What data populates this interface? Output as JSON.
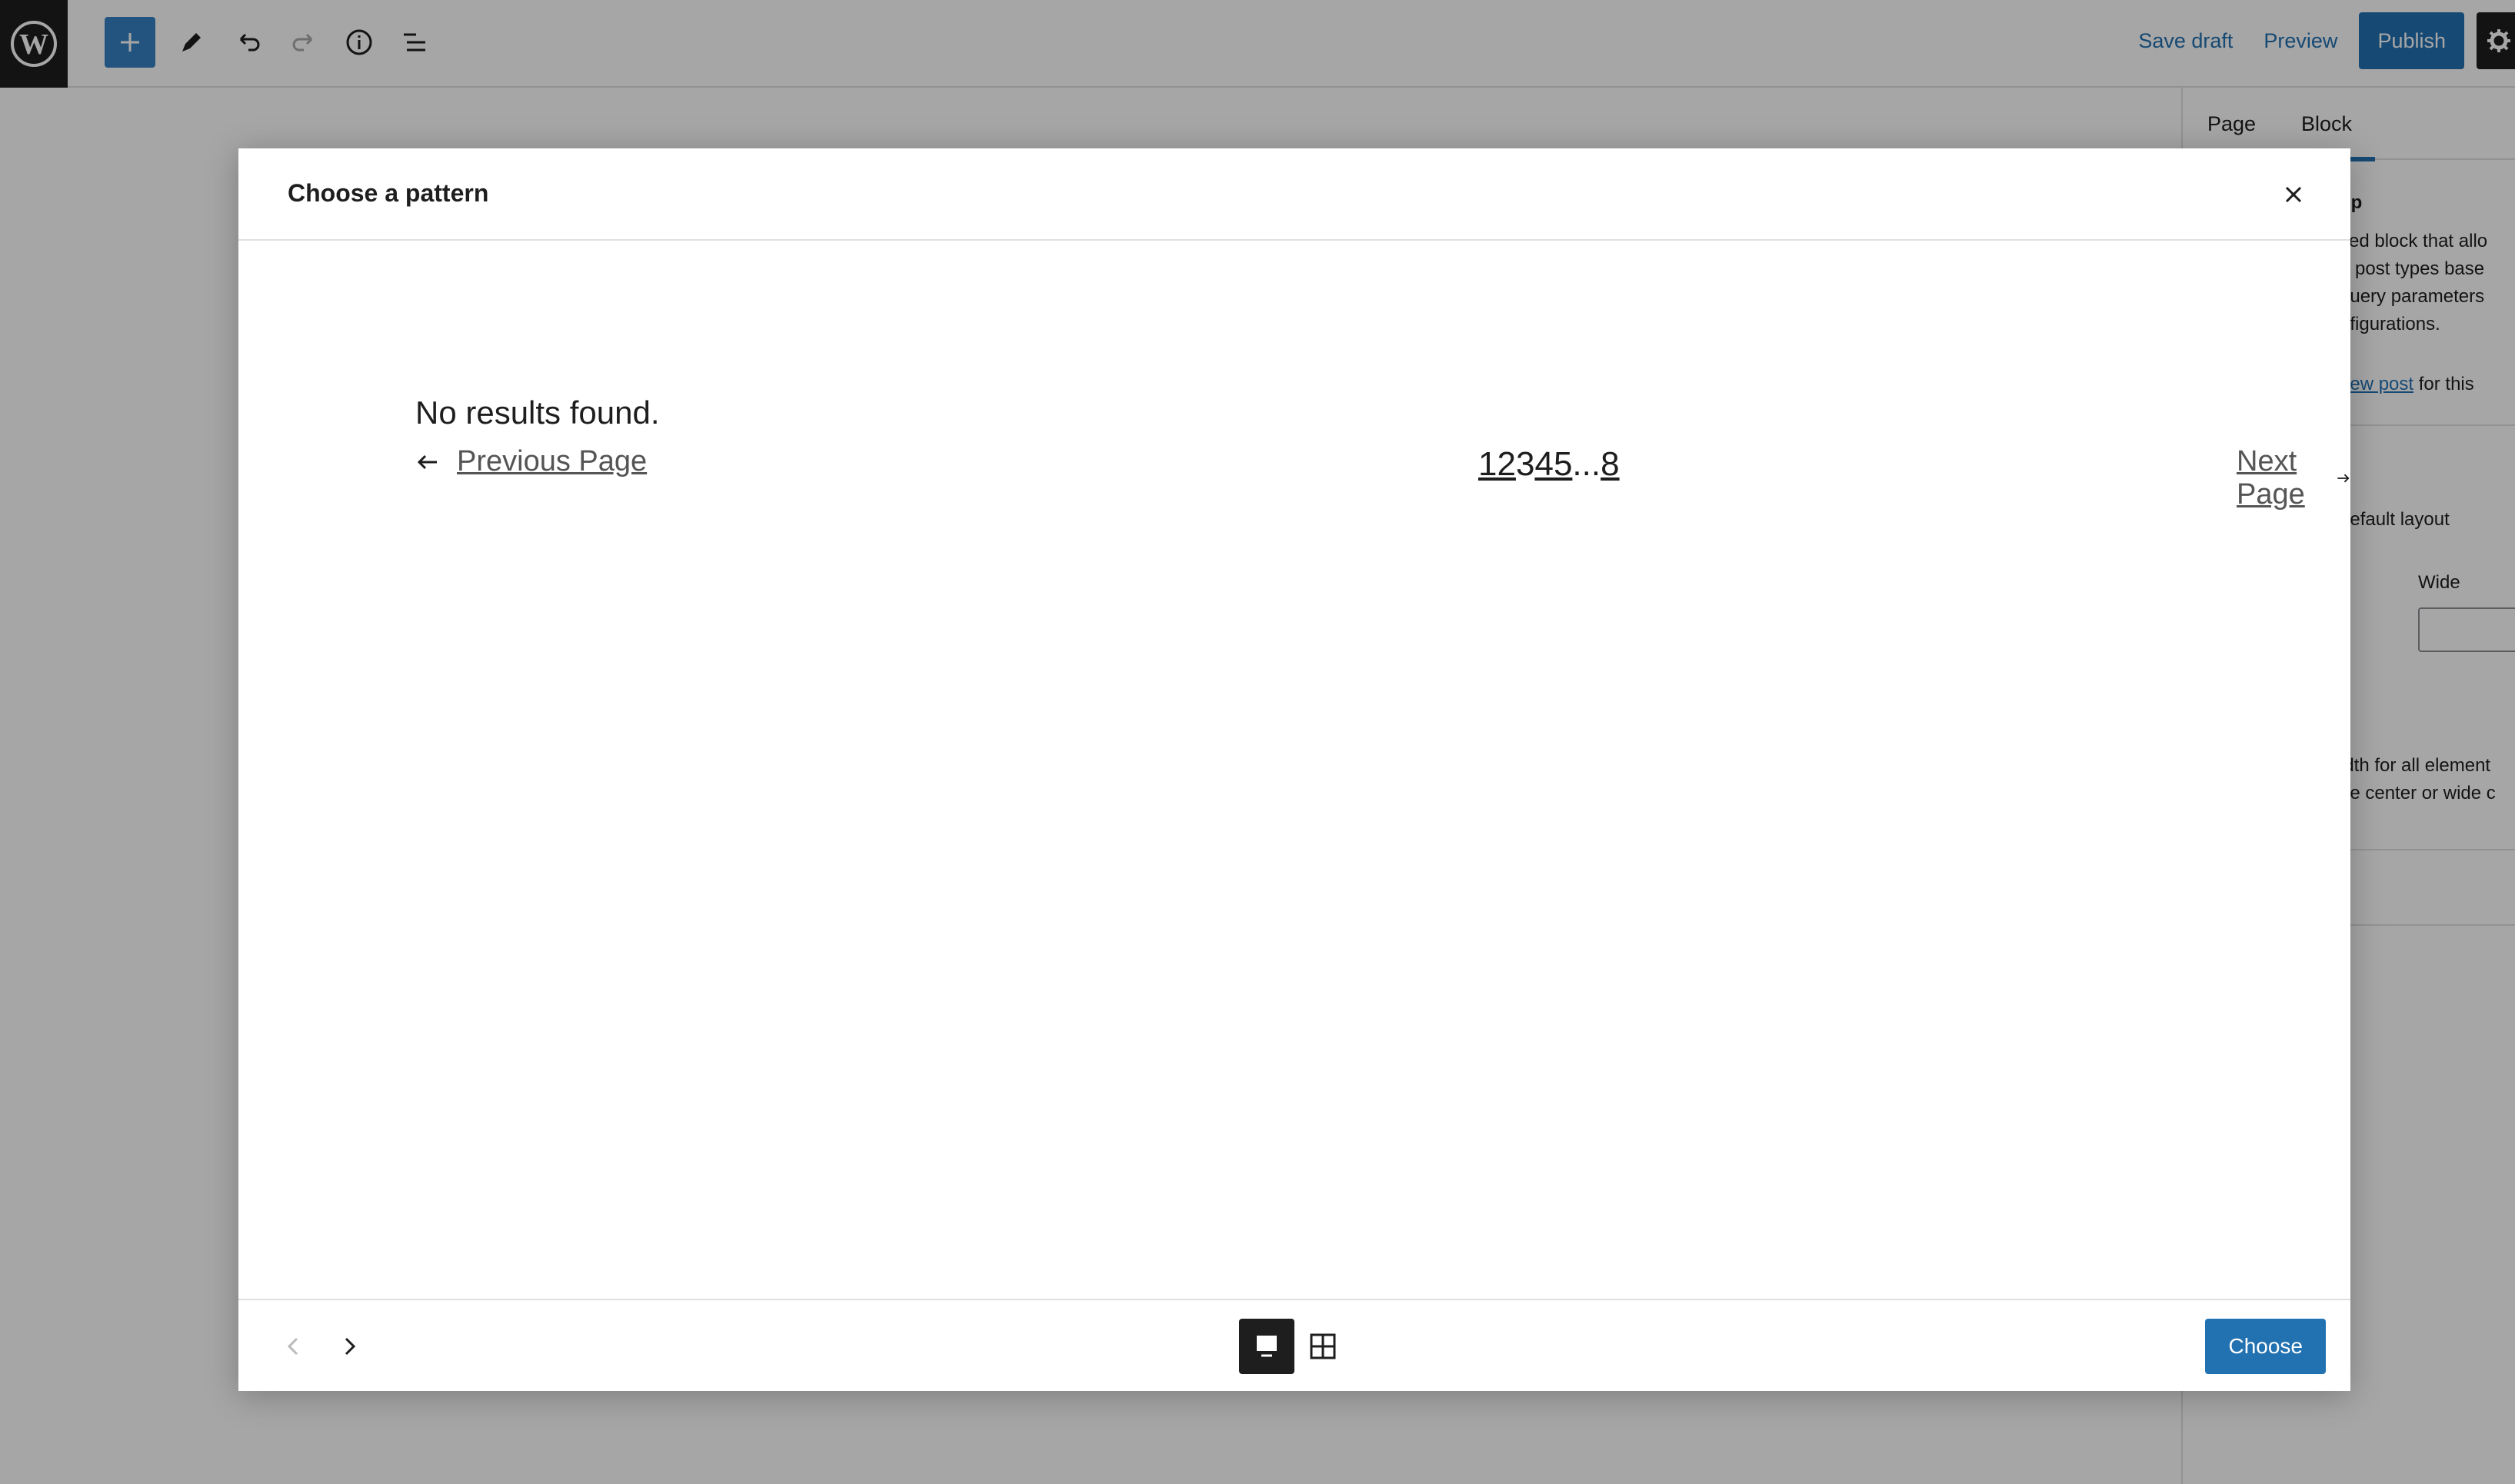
{
  "topbar": {
    "save_draft": "Save draft",
    "preview": "Preview",
    "publish": "Publish"
  },
  "sidebar": {
    "tabs": [
      "Page",
      "Block"
    ],
    "title_fragment": "op",
    "desc_lines": [
      "ced block that allo",
      "g post types base",
      "query parameters",
      "nfigurations."
    ],
    "new_post_link": "new post",
    "new_post_suffix": " for this",
    "layout_label": "default layout",
    "wide_label": "Wide",
    "width_lines": [
      "idth for all element",
      "he center or wide c"
    ]
  },
  "modal": {
    "title": "Choose a pattern",
    "no_results": "No results found.",
    "pagination": {
      "previous": "Previous Page",
      "next": "Next Page",
      "pages": [
        "1",
        "2",
        "3",
        "4",
        "5"
      ],
      "ellipsis": "...",
      "last": "8",
      "current": "3"
    },
    "choose_button": "Choose"
  },
  "colors": {
    "accent": "#2271b1",
    "dark": "#1e1e1e"
  }
}
